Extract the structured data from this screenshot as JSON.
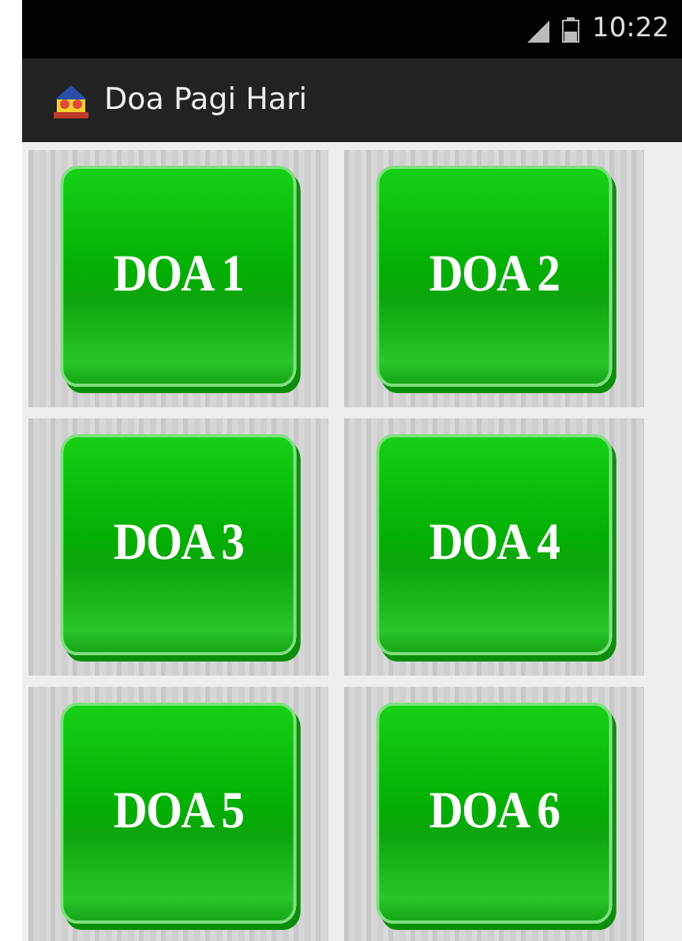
{
  "status_bar": {
    "time": "10:22"
  },
  "action_bar": {
    "title": "Doa Pagi Hari"
  },
  "buttons": [
    {
      "label": "DOA 1"
    },
    {
      "label": "DOA 2"
    },
    {
      "label": "DOA 3"
    },
    {
      "label": "DOA 4"
    },
    {
      "label": "DOA 5"
    },
    {
      "label": "DOA 6"
    }
  ]
}
